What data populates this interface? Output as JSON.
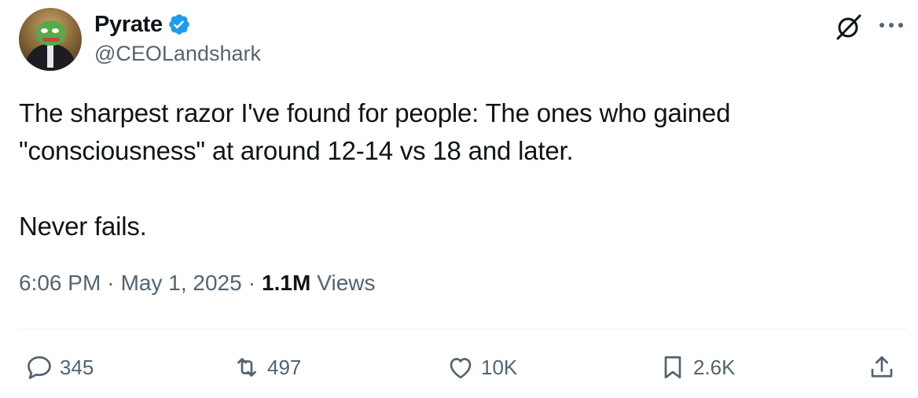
{
  "author": {
    "display_name": "Pyrate",
    "handle": "@CEOLandshark",
    "verified": true
  },
  "tweet": {
    "text": "The sharpest razor I've found for people: The ones who gained \"consciousness\" at around 12-14 vs 18 and later.\n\nNever fails.",
    "time": "6:06 PM",
    "date": "May 1, 2025",
    "views_count": "1.1M",
    "views_label": "Views"
  },
  "actions": {
    "replies": "345",
    "retweets": "497",
    "likes": "10K",
    "bookmarks": "2.6K"
  },
  "icons": {
    "verified": "verified-badge-icon",
    "grok": "grok-icon",
    "more": "more-icon",
    "reply": "reply-icon",
    "retweet": "retweet-icon",
    "like": "heart-icon",
    "bookmark": "bookmark-icon",
    "share": "share-icon"
  },
  "colors": {
    "verified_blue": "#1d9bf0",
    "text": "#0f1419",
    "secondary": "#536471"
  }
}
